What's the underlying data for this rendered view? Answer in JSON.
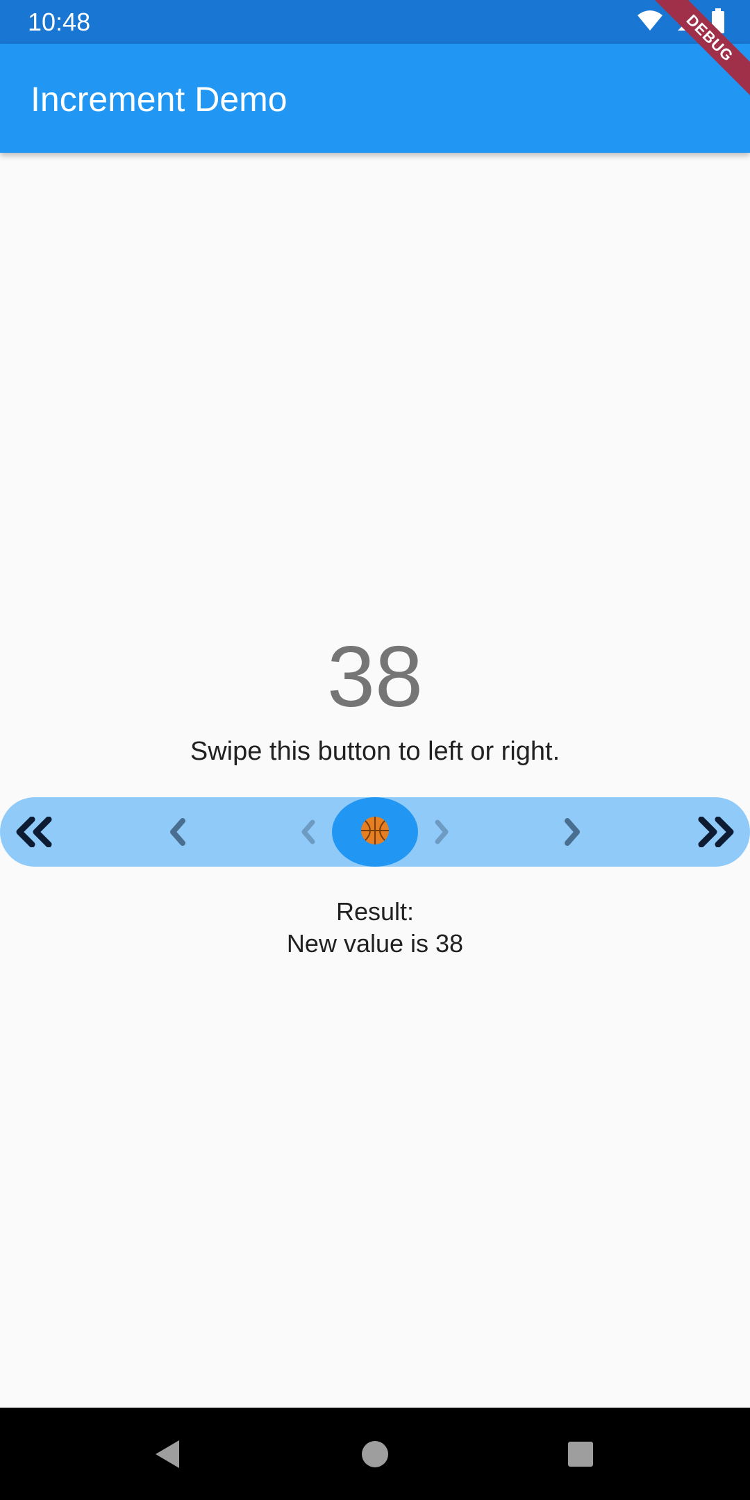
{
  "status_bar": {
    "time": "10:48",
    "icons": [
      "wifi-icon",
      "signal-icon",
      "battery-icon"
    ]
  },
  "app_bar": {
    "title": "Increment Demo",
    "debug_label": "DEBUG"
  },
  "main": {
    "counter_value": "38",
    "instructions": "Swipe this button to left or right.",
    "result_label": "Result:",
    "result_value": "New value is 38"
  },
  "swipe_button": {
    "left_icons": [
      "double-chevron-left-icon",
      "chevron-left-icon",
      "chevron-left-faint-icon"
    ],
    "right_icons": [
      "chevron-right-faint-icon",
      "chevron-right-icon",
      "double-chevron-right-icon"
    ],
    "knob_icon": "basketball-icon"
  },
  "nav_bar": {
    "buttons": [
      "back-icon",
      "home-icon",
      "recents-icon"
    ]
  },
  "colors": {
    "status_bar": "#1976d2",
    "app_bar": "#2196f3",
    "track": "#90caf9",
    "knob": "#2196f3",
    "ball": "#e67e22",
    "background": "#fafafa",
    "debug_ribbon": "#a0304a"
  }
}
